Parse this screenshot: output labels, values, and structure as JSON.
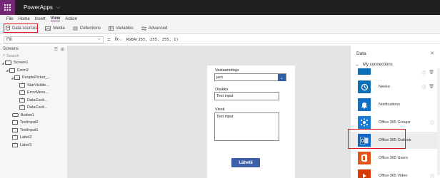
{
  "app": {
    "name": "PowerApps"
  },
  "ribbon": {
    "tabs": [
      "File",
      "Home",
      "Insert",
      "View",
      "Action"
    ],
    "active_tab": "View",
    "tools": {
      "data_sources": "Data sources",
      "media": "Media",
      "collections": "Collections",
      "variables": "Variables",
      "advanced": "Advanced"
    }
  },
  "formula_bar": {
    "property": "Fill",
    "equals": "=",
    "fx": "fx",
    "formula": "RGBA(255, 255, 255, 1)"
  },
  "left_panel": {
    "title": "Screens",
    "search_placeholder": "Search",
    "tree": [
      {
        "label": "Screen1"
      },
      {
        "label": "Form2"
      },
      {
        "label": "PeoplePicker_..."
      },
      {
        "label": "StarVisible..."
      },
      {
        "label": "ErrorMess..."
      },
      {
        "label": "DataCard..."
      },
      {
        "label": "DataCard..."
      },
      {
        "label": "Button1"
      },
      {
        "label": "TextInput2"
      },
      {
        "label": "TextInput1"
      },
      {
        "label": "Label2"
      },
      {
        "label": "Label1"
      }
    ]
  },
  "form": {
    "recipient_label": "Vastaanottaja",
    "recipient_value": "jant",
    "subject_label": "Otsikko",
    "subject_placeholder": "Text input",
    "message_label": "Viesti",
    "message_placeholder": "Text input",
    "send_button": "Lähetä"
  },
  "data_panel": {
    "title": "Data",
    "back_label": "My connections",
    "connections": [
      {
        "label": "Neeko",
        "icon": "neeko-icon",
        "color": "#0b6fb8"
      },
      {
        "label": "Notifications",
        "icon": "notifications-icon",
        "color": "#0f6fc6"
      },
      {
        "label": "Office 365 Groups",
        "icon": "office365-groups-icon",
        "color": "#1a7bd4"
      },
      {
        "label": "Office 365 Outlook",
        "icon": "outlook-icon",
        "color": "#0b66c7"
      },
      {
        "label": "Office 365 Users",
        "icon": "office365-users-icon",
        "color": "#e3541b"
      },
      {
        "label": "Office 365 Video",
        "icon": "office365-video-icon",
        "color": "#d83b01"
      }
    ],
    "selected_connection": "Office 365 Outlook"
  }
}
